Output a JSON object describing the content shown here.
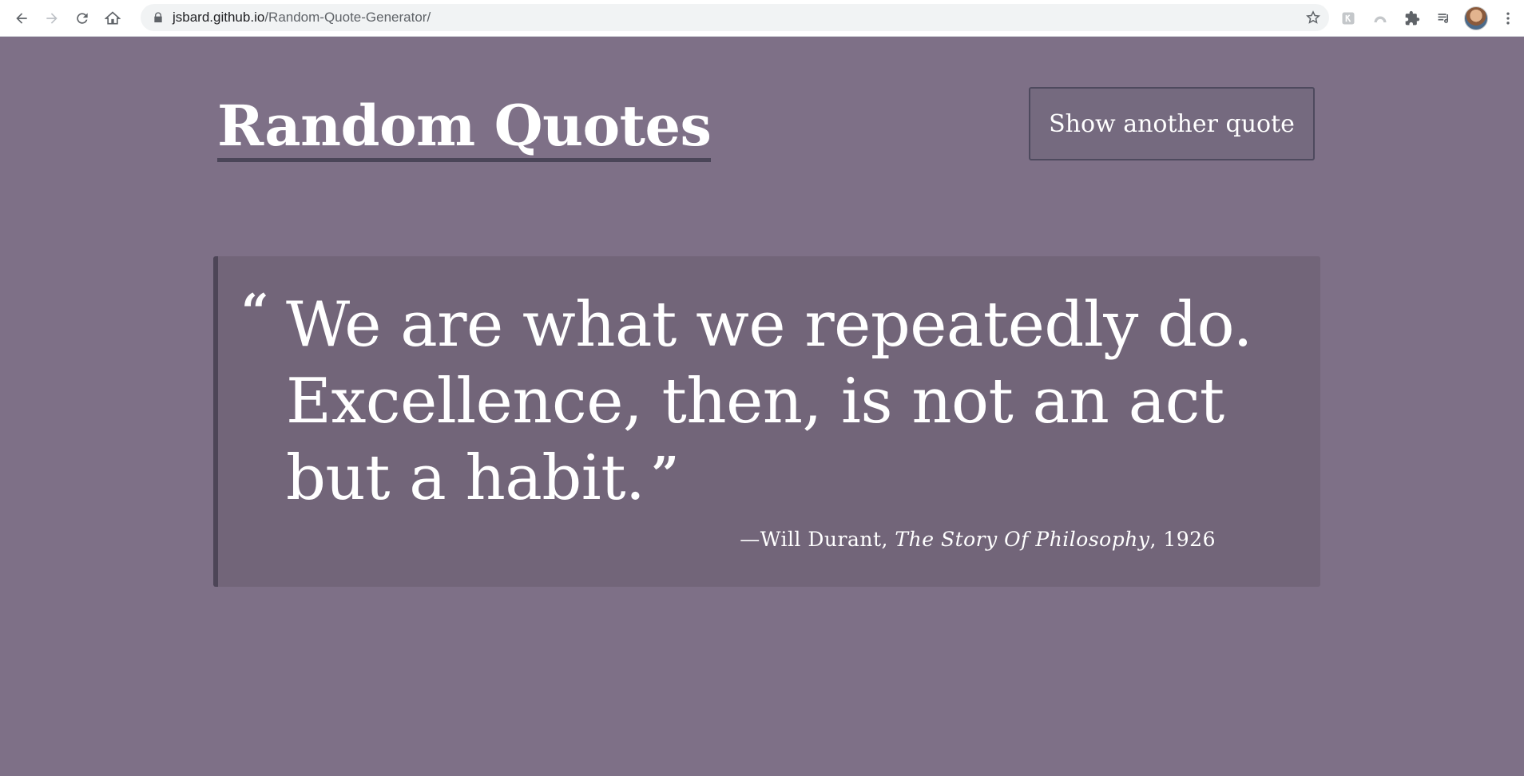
{
  "browser": {
    "url_host": "jsbard.github.io",
    "url_path": "/Random-Quote-Generator/",
    "icons": [
      "back-icon",
      "forward-icon",
      "reload-icon",
      "home-icon",
      "lock-icon",
      "star-icon",
      "extension-icon",
      "profile-icon",
      "puzzle-icon",
      "media-icon",
      "menu-icon"
    ]
  },
  "header": {
    "title": "Random Quotes",
    "button_label": "Show another quote"
  },
  "quote": {
    "open_mark": "“",
    "text": "We are what we repeatedly do. Excellence, then, is not an act but a habit.",
    "close_mark": "”",
    "author_prefix": "—Will Durant, ",
    "source": "The Story Of Philosophy",
    "year_suffix": ", 1926"
  },
  "colors": {
    "background": "#7e7087",
    "card": "#726579",
    "accent_border": "#4d4557",
    "text": "#ffffff"
  }
}
